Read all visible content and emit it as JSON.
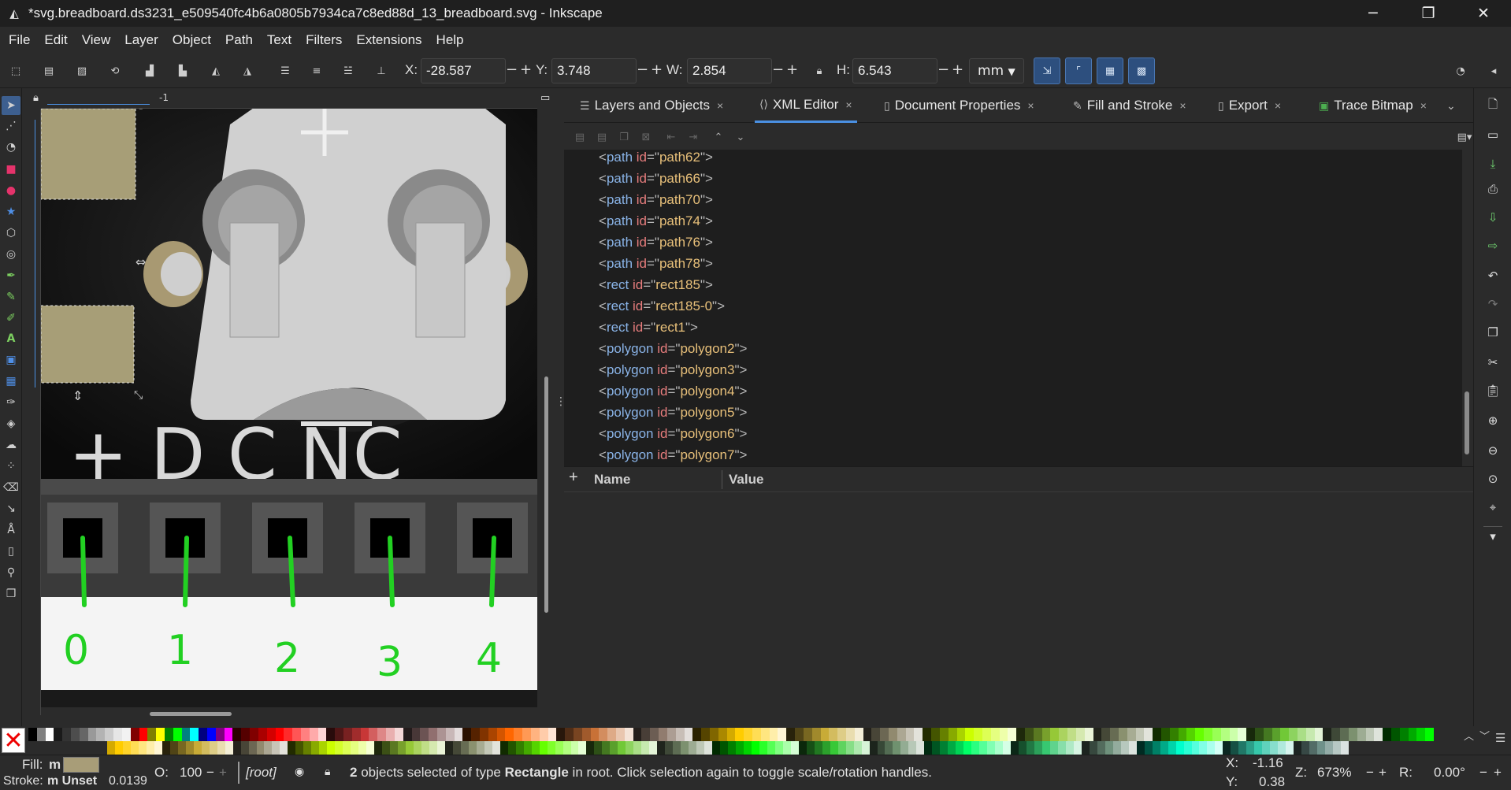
{
  "window": {
    "title": "*svg.breadboard.ds3231_e509540fc4b6a0805b7934ca7c8ed88d_13_breadboard.svg - Inkscape",
    "minimize": "─",
    "maximize": "❐",
    "close": "✕"
  },
  "menu": [
    "File",
    "Edit",
    "View",
    "Layer",
    "Object",
    "Path",
    "Text",
    "Filters",
    "Extensions",
    "Help"
  ],
  "toolbar": {
    "x_label": "X:",
    "x_value": "-28.587",
    "y_label": "Y:",
    "y_value": "3.748",
    "w_label": "W:",
    "w_value": "2.854",
    "h_label": "H:",
    "h_value": "6.543",
    "unit": "mm",
    "minus": "−",
    "plus": "+"
  },
  "ruler": {
    "top_label": "-1"
  },
  "canvas": {
    "pin_labels": [
      "0",
      "1",
      "2",
      "3",
      "4"
    ],
    "silk_text": "+ D C NC"
  },
  "dock": {
    "tabs": [
      {
        "label": "Layers and Objects",
        "icon": "layers-icon"
      },
      {
        "label": "XML Editor",
        "icon": "xml-icon",
        "active": true
      },
      {
        "label": "Document Properties",
        "icon": "document-icon"
      },
      {
        "label": "Fill and Stroke",
        "icon": "fill-stroke-icon"
      },
      {
        "label": "Export",
        "icon": "export-icon"
      },
      {
        "label": "Trace Bitmap",
        "icon": "trace-icon"
      }
    ],
    "tab_close": "×",
    "xml_nodes": [
      {
        "tag": "path",
        "id": "path62"
      },
      {
        "tag": "path",
        "id": "path66"
      },
      {
        "tag": "path",
        "id": "path70"
      },
      {
        "tag": "path",
        "id": "path74"
      },
      {
        "tag": "path",
        "id": "path76"
      },
      {
        "tag": "path",
        "id": "path78"
      },
      {
        "tag": "rect",
        "id": "rect185"
      },
      {
        "tag": "rect",
        "id": "rect185-0"
      },
      {
        "tag": "rect",
        "id": "rect1"
      },
      {
        "tag": "polygon",
        "id": "polygon2"
      },
      {
        "tag": "polygon",
        "id": "polygon3"
      },
      {
        "tag": "polygon",
        "id": "polygon4"
      },
      {
        "tag": "polygon",
        "id": "polygon5"
      },
      {
        "tag": "polygon",
        "id": "polygon6"
      },
      {
        "tag": "polygon",
        "id": "polygon7"
      }
    ],
    "attr_add": "+",
    "attr_name_header": "Name",
    "attr_value_header": "Value"
  },
  "palette": {
    "none_symbol": "✕",
    "row1": [
      "#000000",
      "#808080",
      "#ffffff",
      "#1a1a1a",
      "#333333",
      "#4d4d4d",
      "#666666",
      "#999999",
      "#b3b3b3",
      "#cccccc",
      "#e6e6e6",
      "#f2f2f2",
      "#800000",
      "#ff0000",
      "#808000",
      "#ffff00",
      "#008000",
      "#00ff00",
      "#008080",
      "#00ffff",
      "#000080",
      "#0000ff",
      "#800080",
      "#ff00ff",
      "#2b0000",
      "#550000",
      "#800000",
      "#aa0000",
      "#d40000",
      "#ff0000",
      "#ff2a2a",
      "#ff5555",
      "#ff8080",
      "#ffaaaa",
      "#ffd5d5",
      "#280b0b",
      "#501616",
      "#782121",
      "#a02c2c",
      "#c83737",
      "#d35f5f",
      "#de8787",
      "#e9afaf",
      "#f4d7d7",
      "#241c1c",
      "#483737",
      "#6c5353",
      "#916f6f",
      "#ac9393",
      "#c8b7b7",
      "#e3dbdb",
      "#2b1100",
      "#552200",
      "#803300",
      "#aa4400",
      "#d45500",
      "#ff6600",
      "#ff7f2a",
      "#ff9955",
      "#ffb380",
      "#ffccaa",
      "#ffe6d5",
      "#28170b",
      "#502d16",
      "#784421",
      "#a05a2c",
      "#c87137",
      "#d38d5f",
      "#deaa87",
      "#e9c6af",
      "#f4e3d7",
      "#241f1c",
      "#483e37",
      "#6c5d53",
      "#917c6f",
      "#ac9d93",
      "#c8beb7",
      "#e3dedb",
      "#2b2200",
      "#554400",
      "#806600",
      "#aa8800",
      "#d4aa00",
      "#ffcc00",
      "#ffd42a",
      "#ffdd55",
      "#ffe680",
      "#ffeeaa",
      "#fff6d5",
      "#28220b",
      "#504416",
      "#786721",
      "#a0892c",
      "#c8ab37",
      "#d3bc5f",
      "#decd87",
      "#e9ddaf",
      "#f4eed7",
      "#24221c",
      "#484537",
      "#6c6753",
      "#918a6f",
      "#aca793",
      "#c8c4b7",
      "#e3e2db",
      "#222b00",
      "#445500",
      "#668000",
      "#88aa00",
      "#aad400",
      "#ccff00",
      "#d4ff2a",
      "#ddff55",
      "#e5ff80",
      "#eeffaa",
      "#f6ffd5",
      "#1e280b",
      "#3c5016",
      "#5a7821",
      "#78a02c",
      "#96c837",
      "#abd35f",
      "#c0de87",
      "#d5e9af",
      "#eaf4d7",
      "#22241c",
      "#454837",
      "#676c53",
      "#8a916f",
      "#a7ac93",
      "#c4c8b7",
      "#e2e3db",
      "#112b00",
      "#225500",
      "#338000",
      "#44aa00",
      "#55d400",
      "#66ff00",
      "#7fff2a",
      "#99ff55",
      "#b3ff80",
      "#ccffaa",
      "#e5ffd5",
      "#17280b",
      "#2d5016",
      "#447821",
      "#5aa02c",
      "#71c837",
      "#8dd35f",
      "#aade87",
      "#c6e9af",
      "#e3f4d7",
      "#1f241c",
      "#3e4837",
      "#5d6c53",
      "#7c916f",
      "#9dac93",
      "#bec8b7",
      "#dee3db",
      "#002b00",
      "#005500",
      "#008000",
      "#00aa00",
      "#00d400",
      "#00ff00"
    ],
    "row2": [
      "#d4aa00",
      "#ffcc00",
      "#ffd42a",
      "#ffdd55",
      "#ffe680",
      "#ffeeaa",
      "#fff6d5",
      "#28220b",
      "#504416",
      "#786721",
      "#a0892c",
      "#c8ab37",
      "#d3bc5f",
      "#decd87",
      "#e9ddaf",
      "#f4eed7",
      "#24221c",
      "#484537",
      "#6c6753",
      "#918a6f",
      "#aca793",
      "#c8c4b7",
      "#e3e2db",
      "#222b00",
      "#445500",
      "#668000",
      "#88aa00",
      "#aad400",
      "#ccff00",
      "#d4ff2a",
      "#ddff55",
      "#e5ff80",
      "#eeffaa",
      "#f6ffd5",
      "#1e280b",
      "#3c5016",
      "#5a7821",
      "#78a02c",
      "#96c837",
      "#abd35f",
      "#c0de87",
      "#d5e9af",
      "#eaf4d7",
      "#22241c",
      "#454837",
      "#676c53",
      "#8a916f",
      "#a7ac93",
      "#c4c8b7",
      "#e2e3db",
      "#112b00",
      "#225500",
      "#338000",
      "#44aa00",
      "#55d400",
      "#66ff00",
      "#7fff2a",
      "#99ff55",
      "#b3ff80",
      "#ccffaa",
      "#e5ffd5",
      "#17280b",
      "#2d5016",
      "#447821",
      "#5aa02c",
      "#71c837",
      "#8dd35f",
      "#aade87",
      "#c6e9af",
      "#e3f4d7",
      "#1f241c",
      "#3e4837",
      "#5d6c53",
      "#7c916f",
      "#9dac93",
      "#bec8b7",
      "#dee3db",
      "#002b00",
      "#005500",
      "#008000",
      "#00aa00",
      "#00d400",
      "#00ff00",
      "#2aff2a",
      "#55ff55",
      "#80ff80",
      "#aaffaa",
      "#d5ffd5",
      "#0b280b",
      "#165016",
      "#217821",
      "#2ca02c",
      "#37c837",
      "#5fd35f",
      "#87de87",
      "#afe9af",
      "#d7f4d7",
      "#1c241c",
      "#374837",
      "#536c53",
      "#6f916f",
      "#93ac93",
      "#b7c8b7",
      "#dbe3db",
      "#002b11",
      "#005522",
      "#008033",
      "#00aa44",
      "#00d455",
      "#00ff66",
      "#2aff80",
      "#55ff99",
      "#80ffb3",
      "#aaffcc",
      "#d5ffe6",
      "#0b2817",
      "#16502d",
      "#217844",
      "#2ca05a",
      "#37c871",
      "#5fd38d",
      "#87deaa",
      "#afe9c6",
      "#d7f4e3",
      "#1c241f",
      "#37483e",
      "#536c5d",
      "#6f917c",
      "#93ac9d",
      "#b7c8be",
      "#dbe3de",
      "#002b22",
      "#005544",
      "#008066",
      "#00aa88",
      "#00d4aa",
      "#00ffcc",
      "#2affd5",
      "#55ffdd",
      "#80ffe6",
      "#aaffee",
      "#d5fff6",
      "#0b2822",
      "#165044",
      "#217867",
      "#2ca089",
      "#37c8ab",
      "#5fd3bc",
      "#87decd",
      "#afe9dd",
      "#d7f4ee",
      "#1c2422",
      "#374845",
      "#536c67",
      "#6f918a",
      "#93aca7",
      "#b7c8c4",
      "#dbe3e2"
    ],
    "scroll_up": "︿",
    "scroll_down": "﹀",
    "menu": "☰"
  },
  "status": {
    "fill_label": "Fill:",
    "fill_value": "m",
    "fill_color": "#a89d78",
    "stroke_label": "Stroke:",
    "stroke_value": "m Unset",
    "stroke_width": "0.0139",
    "opacity_label": "O:",
    "opacity_value": "100",
    "layer": "[root]",
    "msg_count": "2",
    "msg_a": " objects selected of type ",
    "msg_type": "Rectangle",
    "msg_b": " in root. Click selection again to toggle scale/rotation handles.",
    "x_label": "X:",
    "x_value": "-1.16",
    "y_label": "Y:",
    "y_value": "0.38",
    "zoom_label": "Z:",
    "zoom_value": "673%",
    "rot_label": "R:",
    "rot_value": "0.00°"
  }
}
